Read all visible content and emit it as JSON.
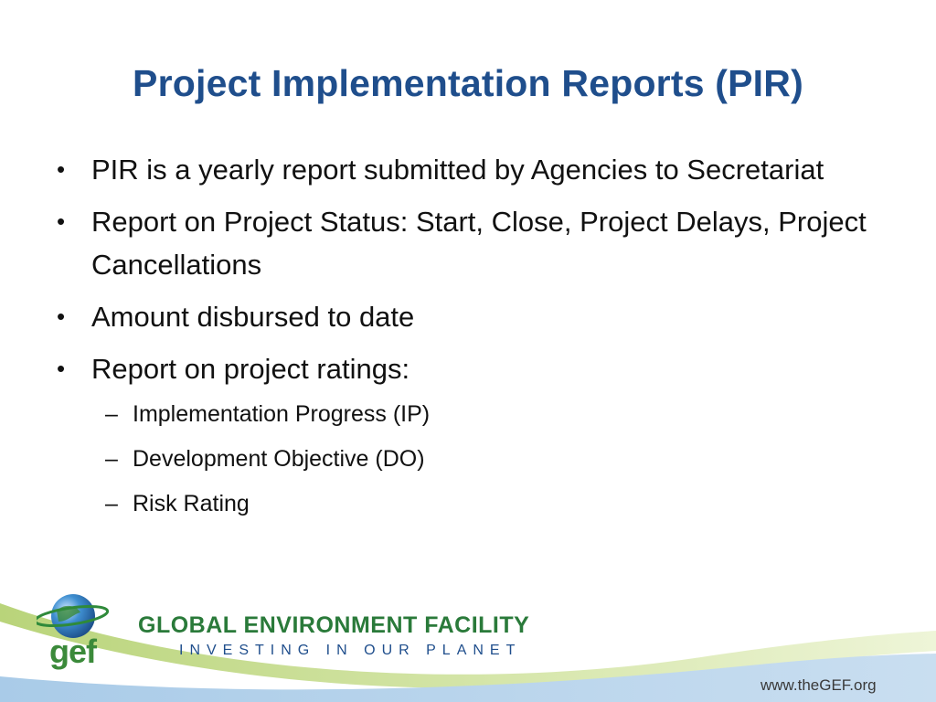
{
  "slide": {
    "title": "Project Implementation Reports (PIR)",
    "bullet_symbol": "•",
    "sub_symbol": "–",
    "bullets": [
      {
        "text": "PIR is a yearly report submitted by Agencies to Secretariat"
      },
      {
        "text": "Report on Project Status: Start, Close, Project Delays, Project Cancellations"
      },
      {
        "text": "Amount disbursed to date"
      },
      {
        "text": "Report on project ratings:"
      }
    ],
    "sub_bullets": [
      {
        "text": "Implementation Progress (IP)"
      },
      {
        "text": "Development Objective (DO)"
      },
      {
        "text": "Risk Rating"
      }
    ]
  },
  "footer": {
    "logo_text": "gef",
    "org_name": "GLOBAL ENVIRONMENT FACILITY",
    "tagline": "INVESTING IN OUR PLANET",
    "url": "www.theGEF.org"
  },
  "colors": {
    "title": "#1f4e8c",
    "brand_green": "#2a7a3a",
    "brand_blue": "#1f4e8c"
  }
}
